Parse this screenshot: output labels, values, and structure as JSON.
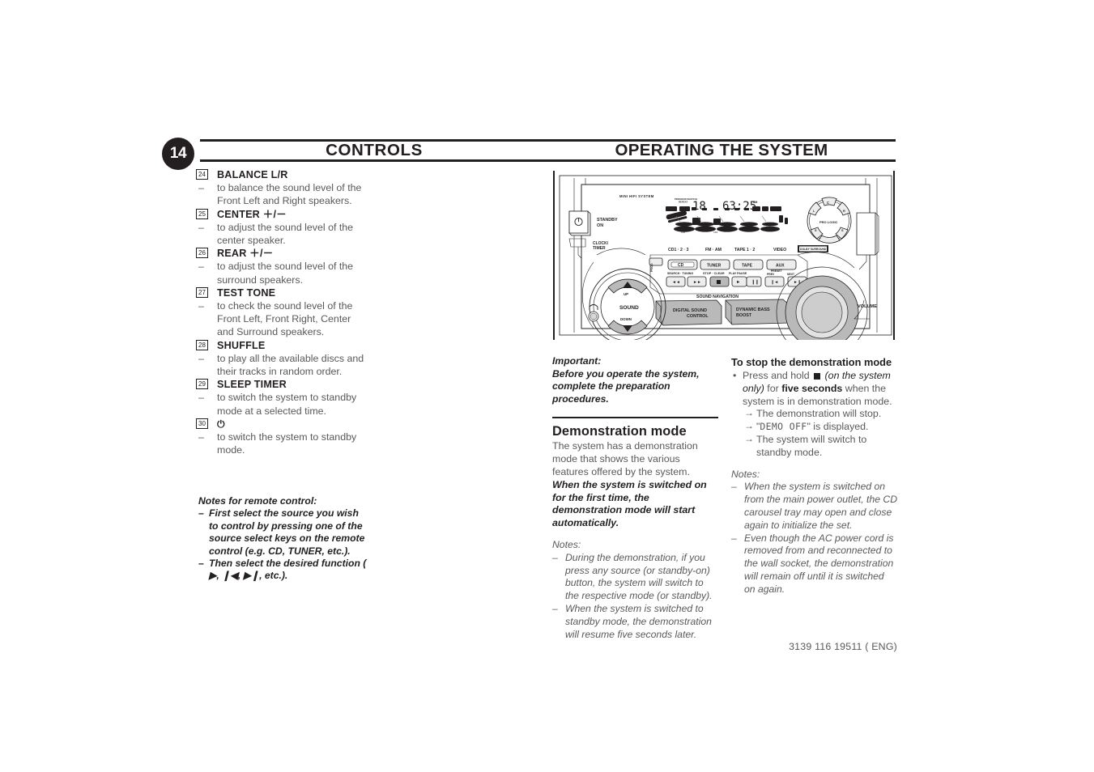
{
  "page": {
    "number": "14",
    "header_left": "CONTROLS",
    "header_right": "OPERATING THE SYSTEM",
    "footer": "3139 116 19511 ( ENG)"
  },
  "controls": [
    {
      "num": "24",
      "title": "BALANCE L/R",
      "dash": "–",
      "desc": "to balance the sound level of the Front Left and Right speakers."
    },
    {
      "num": "25",
      "title": "CENTER ＋/－",
      "dash": "–",
      "desc": "to adjust the sound level of the center speaker."
    },
    {
      "num": "26",
      "title": "REAR ＋/－",
      "dash": "–",
      "desc": "to adjust the sound level of the surround speakers."
    },
    {
      "num": "27",
      "title": "TEST TONE",
      "dash": "–",
      "desc": "to check the sound level of the Front Left, Front Right, Center and Surround speakers."
    },
    {
      "num": "28",
      "title": "SHUFFLE",
      "dash": "–",
      "desc": "to play all the available discs and their tracks in random order."
    },
    {
      "num": "29",
      "title": "SLEEP TIMER",
      "dash": "–",
      "desc": "to switch the system to standby mode at a selected time."
    },
    {
      "num": "30",
      "title": "⏻",
      "dash": "–",
      "desc": "to switch the system to standby mode."
    }
  ],
  "remote_notes": {
    "heading": "Notes for remote control:",
    "items": [
      "First select the source you wish to control by pressing one of the source select keys on the remote control (e.g.  CD,  TUNER, etc.).",
      "Then select the desired function ( ▶,  ❙◀,  ▶❙,  etc.)."
    ],
    "bullet": "–"
  },
  "illustration": {
    "brand_label": "MINI HIFI SYSTEM",
    "standby_label_line1": "STANDBY",
    "standby_label_line2": "ON",
    "clock_timer_line1": "CLOCK/",
    "clock_timer_line2": "TIMER",
    "headphone_icon": "headphone-icon",
    "power_icon": "power-icon",
    "sound_wheel": {
      "up": "UP",
      "down": "DOWN",
      "center": "SOUND"
    },
    "source_header": [
      "CD1 · 2 · 3",
      "FM · AM",
      "TAPE 1 · 2",
      "VIDEO"
    ],
    "dolby_badge": "DOLBY SURROUND PRO LOGIC",
    "prog_label": "PROG",
    "source_buttons": [
      "CD",
      "TUNER",
      "TAPE",
      "AUX"
    ],
    "transport_labels": [
      "SEARCH · TUNING",
      "STOP · CLEAR",
      "PLAY  PAUSE",
      "PRESET",
      "PREV",
      "NEXT"
    ],
    "transport_buttons": [
      "◀◀",
      "▶▶",
      "■",
      "▶",
      "❙❙",
      "❙◀◀",
      "▶▶❙"
    ],
    "sound_navigation_label": "SOUND NAVIGATION",
    "dsc_label_line1": "DIGITAL SOUND",
    "dsc_label_line2": "CONTROL",
    "dbb_label_line1": "DYNAMIC BASS",
    "dbb_label_line2": "BOOST",
    "volume_label": "VOLUME",
    "pro_logic_label": "PRO LOGIC",
    "pro_logic_keys": [
      "C",
      "L",
      "R",
      "S",
      "S"
    ],
    "display": {
      "program_shuffle": "PROGRAM SHUFFLE",
      "repeat": "REPEAT",
      "track_number": "18",
      "time": "63:25",
      "indicators": [
        "PROG",
        "DBB",
        "RDS",
        "SLEEP",
        "TIMER",
        "MHZ",
        "KHZ"
      ]
    }
  },
  "mid_column": {
    "important_label": "Important:",
    "important_text": "Before you operate the system, complete the preparation procedures.",
    "section_title": "Demonstration mode",
    "body_normal_1": "The system has a demonstration mode that shows the various features offered by the system. ",
    "body_bold_1": "When the system is switched on for the first time, the demonstration mode will start automatically.",
    "notes_label": "Notes:",
    "notes": [
      "During the demonstration, if you press any source (or standby-on) button, the system will switch to the respective mode (or standby).",
      "When the system is switched to standby mode, the demonstration will resume five seconds later."
    ],
    "note_bullet": "–"
  },
  "right_column": {
    "heading": "To stop the demonstration mode",
    "bullet": "•",
    "press_text_1": "Press and hold ",
    "press_text_2": " (on the system only)",
    "press_text_3": " for ",
    "press_bold": "five seconds",
    "press_text_4": " when the system is in demonstration mode.",
    "arrow": "→",
    "arrows": [
      "The demonstration will stop.",
      "The system will switch to standby mode."
    ],
    "demo_off_prefix": "\"",
    "demo_off": "DEMO OFF",
    "demo_off_suffix": "\" is displayed.",
    "notes_label": "Notes:",
    "note_bullet": "–",
    "notes": [
      "When the system is switched on from the main power outlet, the CD carousel tray may open and close again to initialize the set.",
      "Even though the AC power cord is removed from and reconnected to the wall socket, the demonstration will remain off until it is switched on again."
    ]
  },
  "colors": {
    "ink": "#231f20",
    "body": "#58595b",
    "panel_gray": "#b3b3b3",
    "light_gray": "#e6e6e6"
  }
}
